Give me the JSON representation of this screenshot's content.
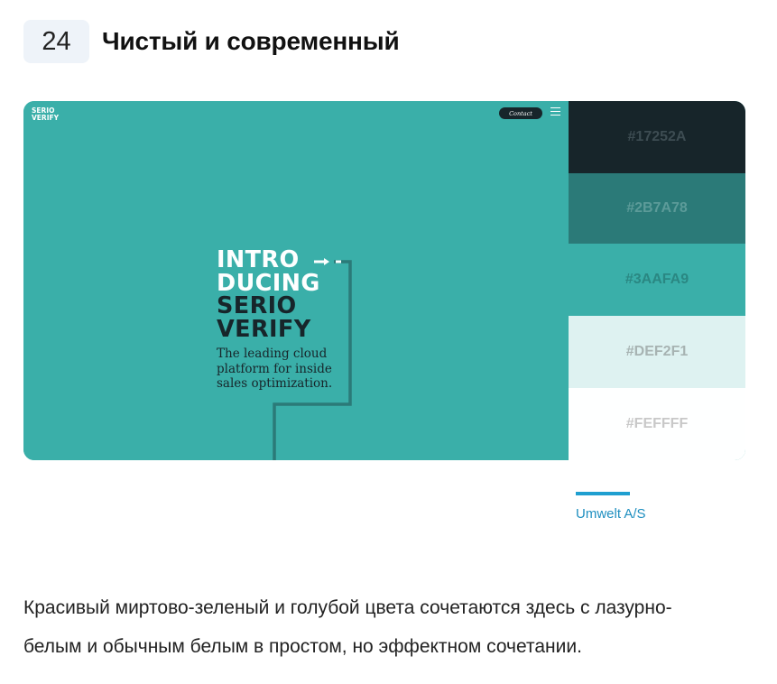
{
  "header": {
    "number": "24",
    "title": "Чистый и современный"
  },
  "preview": {
    "logo_line1": "SERIO",
    "logo_line2": "VERIFY",
    "contact_label": "Contact",
    "hero_lines": [
      "INTRO",
      "DUCING",
      "SERIO",
      "VERIFY"
    ],
    "hero_subtitle": [
      "The leading cloud",
      "platform for inside",
      "sales optimization."
    ],
    "background_color": "#3AAFA9"
  },
  "palette": [
    {
      "hex": "#17252A",
      "label": "#17252A",
      "text_color": "#3d4c52"
    },
    {
      "hex": "#2B7A78",
      "label": "#2B7A78",
      "text_color": "#5c9b99"
    },
    {
      "hex": "#3AAFA9",
      "label": "#3AAFA9",
      "text_color": "#2a8782"
    },
    {
      "hex": "#DEF2F1",
      "label": "#DEF2F1",
      "text_color": "#a7b3b2"
    },
    {
      "hex": "#FEFFFF",
      "label": "#FEFFFF",
      "text_color": "#c8c8c8"
    }
  ],
  "author": {
    "name": "Umwelt A/S",
    "accent_color": "#1F9FD0"
  },
  "description": {
    "line1": "Красивый миртово-зеленый и голубой цвета сочетаются здесь с лазурно-",
    "line2": "белым и обычным белым в простом, но эффектном сочетании."
  }
}
